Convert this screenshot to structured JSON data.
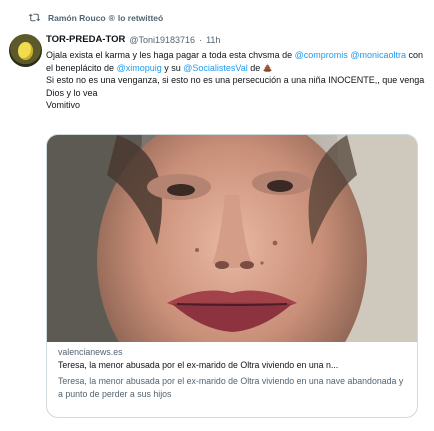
{
  "retweet": {
    "icon": "retweet-icon",
    "name": "Ramón Rouco",
    "badge": "®",
    "action": "lo retwitteó"
  },
  "tweet": {
    "author_name": "TOR-PREDA-TOR",
    "handle": "@Toni19183716",
    "separator": "·",
    "time": "11h",
    "text": {
      "p1_a": "Ojala exista el karma y les haga pagar a toda esta chvsma de ",
      "m1": "@compromis",
      "m2": "@monicaoltra",
      "p1_b": " con el beneplácito de ",
      "m3": "@ximopuig",
      "p1_c": " y su ",
      "m4": "@SocialistesVal",
      "p1_d": " de ",
      "line3": "Si esto no es una venganza, si esto no es una persecución a una niña INOCENTE,, que venga Dios y lo vea",
      "line4": "Vomitivo"
    }
  },
  "card": {
    "domain": "valencianews.es",
    "title": "Teresa, la menor abusada por el ex-marido de Oltra viviendo en una n...",
    "description": "Teresa, la menor abusada por el ex-marido de Oltra viviendo en una nave abandonada y a punto de perder a sus hijos"
  },
  "colors": {
    "link": "#1d9bf0",
    "muted": "#536471",
    "border": "#cfd9de"
  }
}
